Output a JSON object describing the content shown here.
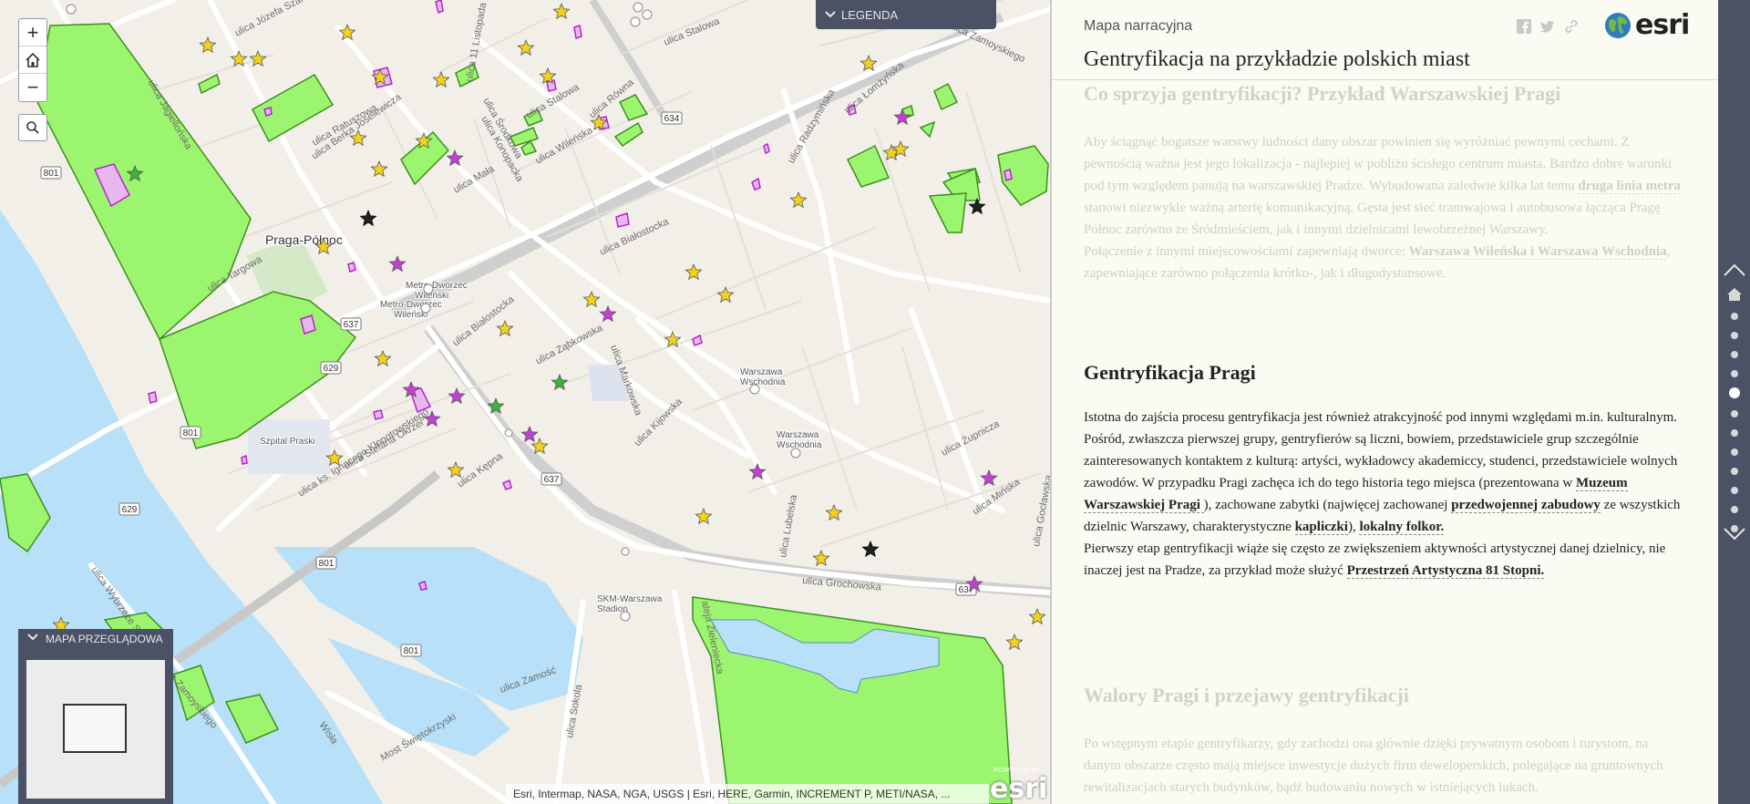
{
  "map": {
    "zoom_in": "+",
    "zoom_out": "−",
    "legend_label": "LEGENDA",
    "overview_label": "MAPA PRZEGLĄDOWA",
    "attribution": "Esri, Intermap, NASA, NGA, USGS | Esri, HERE, Garmin, INCREMENT P, METI/NASA, ...",
    "powered_by": "POWERED BY",
    "esri_word": "esri",
    "place_labels": [
      {
        "text": "Praga-Północ"
      }
    ],
    "poi_labels": [
      "Metro-Dworzec Wileński",
      "Metro-Dworzec Wileński",
      "Szpital Praski",
      "Warszawa Wschodnia",
      "Warszawa Wschodnia",
      "SKM-Warszawa Stadion"
    ],
    "road_labels": [
      "ulica Jagiellońska",
      "ulica Józefa Szanajcy",
      "ulica Berka Joselewicza",
      "ulica Ratuszowa",
      "ulica Mała",
      "ulica Środkowa",
      "ulica Konopacka",
      "ulica 11 Listopada",
      "ulica Stalowa",
      "ulica Stalowa",
      "ulica Równa",
      "ulica Wileńska",
      "ulica Białostocka",
      "ulica Białostocka",
      "ulica Ząbkowska",
      "ulica Markowska",
      "ulica Kijowska",
      "ulica Radzymińska",
      "ulica Łomżyńska",
      "ulica Stefana Okrzei",
      "ulica ks. Ignacego Kłopotowskiego",
      "ulica Kępna",
      "ulica Lubelska",
      "ulica Grochowska",
      "ulica Mińska",
      "ulica Żupnicza",
      "ulica Gocławska",
      "ulica Zamoyskiego",
      "ulica Zamoyskiego",
      "ulica Wybrzeże Szczecińskie",
      "Wisła",
      "Most Świętokrzyski",
      "aleja Zieleniecka",
      "ulica Sokola",
      "ulica Zamość",
      "ulica Targowa"
    ],
    "route_shields": [
      "634",
      "801",
      "637",
      "629",
      "801",
      "637",
      "629",
      "801",
      "801",
      "637"
    ]
  },
  "panel": {
    "app_subtitle": "Mapa narracyjna",
    "app_title": "Gentryfikacja na przykładzie polskich miast",
    "logo_word": "esri",
    "sections": {
      "s1": {
        "heading": "Co sprzyja gentryfikacji? Przykład Warszawskiej Pragi",
        "p1_a": "Aby ściągnąć bogatsze warstwy ludności dany obszar powinien się wyróżniać pewnymi cechami. Z pewnością ważna jest jego lokalizacja - najlepiej w pobliżu ścisłego centrum miasta. Bardzo dobre warunki pod tym względem panują na warszawskiej Pradze. Wybudowana zaledwie kilka lat temu ",
        "p1_link": "druga linia metra",
        "p1_b": " stanowi niezwykle ważną arterię komunikacyjną. Gęsta jest sieć tramwajowa i autobusowa łącząca Pragę Północ zarówno ze Śródmieściem, jak i innymi dzielnicami lewobrzeżnej Warszawy.",
        "p2_a": "Połączenie z innymi miejscowościami zapewniają dworce: ",
        "p2_link": "Warszawa Wileńska i Warszawa Wschodnia",
        "p2_b": ", zapewniające zarówno połączenia krótko-, jak i długodystansowe."
      },
      "s2": {
        "heading": "Gentryfikacja Pragi",
        "t1": "Istotna do zajścia procesu gentryfikacja jest również atrakcyjność pod innymi względami m.in. kulturalnym. Pośród, zwłaszcza pierwszej grupy, gentryfierów są liczni, bowiem, przedstawiciele grup szczególnie zainteresowanych kontaktem z kulturą: artyści, wykładowcy akademiccy, studenci, przedstawiciele wolnych zawodów. W przypadku Pragi zachęca ich do tego historia tego miejsca (prezentowana w ",
        "l1": "Muzeum Warszawskiej Pragi ",
        "t2": "), zachowane zabytki (najwięcej zachowanej ",
        "l2": "przedwojennej zabudowy",
        "t3": " ze wszystkich dzielnic Warszawy, charakterystyczne ",
        "l3": "kapliczki",
        "t4": "), ",
        "l4": "lokalny folkor.",
        "t5": "Pierwszy etap gentryfikacji wiąże się często ze zwiększeniem aktywności artystycznej danej dzielnicy, nie inaczej jest na Pradze, za przykład może służyć ",
        "l5": "Przestrzeń Artystyczna 81 Stopni."
      },
      "s3": {
        "heading": "Walory Pragi i przejawy gentryfikacji",
        "p1": "Po wstępnym etapie gentryfikarzy, gdy zachodzi ona głównie dzięki prywatnym osobom i turystom, na danym obszarze często mają miejsce inwestycje dużych firm deweloperskich, polegające na gruntownych rewitalizacjach starych budynków, bądź budowaniu nowych w istniejących lukach."
      }
    }
  },
  "rail": {
    "dots": 12,
    "active_dot": 4
  },
  "colors": {
    "park_fill": "#9cf56e",
    "park_stroke": "#3d8f1e",
    "water": "#b8e1f9",
    "purple": "#c53bd6",
    "star_yellow": "#f2d21c",
    "star_purple": "#c33fd3",
    "star_green": "#3bb43b",
    "rail_bg": "#4c5266"
  }
}
